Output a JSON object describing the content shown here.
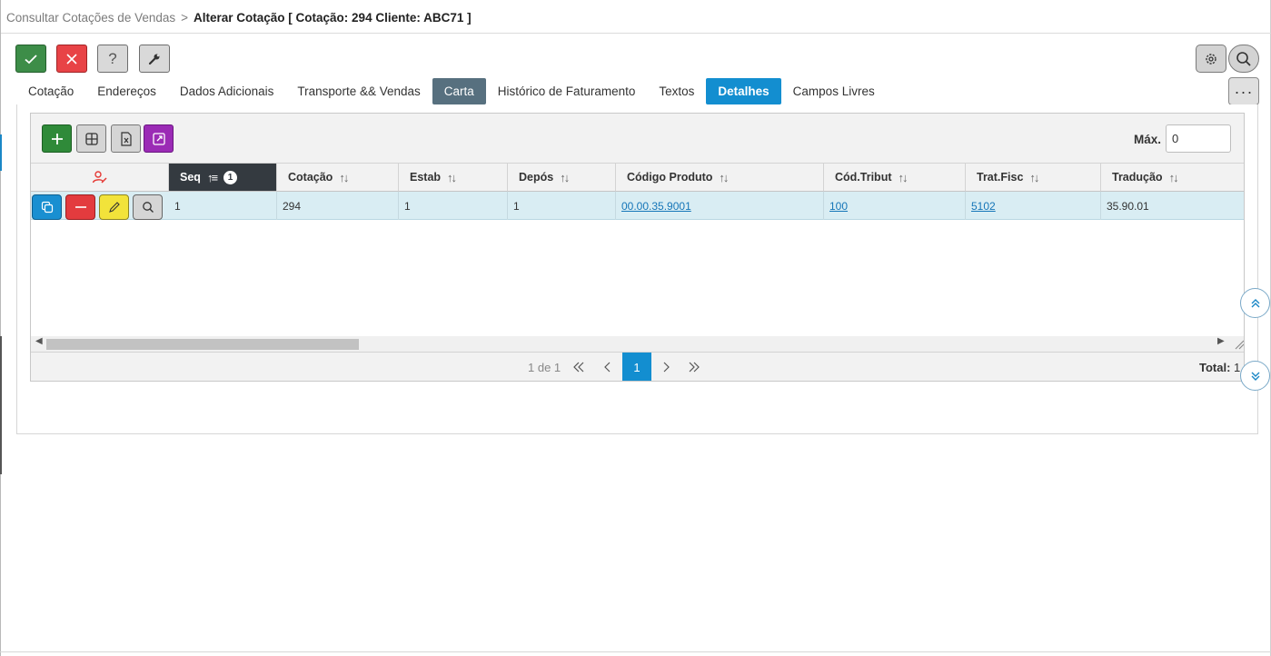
{
  "breadcrumb": {
    "parent": "Consultar Cotações de Vendas",
    "separator": ">",
    "current": "Alterar Cotação [ Cotação: 294 Cliente: ABC71 ]"
  },
  "toolbar": {
    "help_label": "?"
  },
  "more_label": "···",
  "tabs": [
    {
      "label": "Cotação"
    },
    {
      "label": "Endereços"
    },
    {
      "label": "Dados Adicionais"
    },
    {
      "label": "Transporte && Vendas"
    },
    {
      "label": "Carta"
    },
    {
      "label": "Histórico de Faturamento"
    },
    {
      "label": "Textos"
    },
    {
      "label": "Detalhes"
    },
    {
      "label": "Campos Livres"
    }
  ],
  "grid": {
    "max_label": "Máx.",
    "max_value": "0",
    "columns": [
      "Seq",
      "Cotação",
      "Estab",
      "Depós",
      "Código Produto",
      "Cód.Tribut",
      "Trat.Fisc",
      "Tradução"
    ],
    "sort_badge": "1",
    "row": {
      "seq": "1",
      "cotacao": "294",
      "estab": "1",
      "depos": "1",
      "codigo_produto": "00.00.35.9001",
      "cod_tribut": "100",
      "trat_fisc": "5102",
      "traducao": "35.90.01"
    }
  },
  "pager": {
    "page_info": "1 de 1",
    "current_page": "1",
    "total_label": "Total:",
    "total_value": "1"
  },
  "colors": {
    "accent": "#138ed0",
    "ok": "#3d8d48",
    "cancel": "#e84346",
    "row_selected": "#d9edf3"
  }
}
